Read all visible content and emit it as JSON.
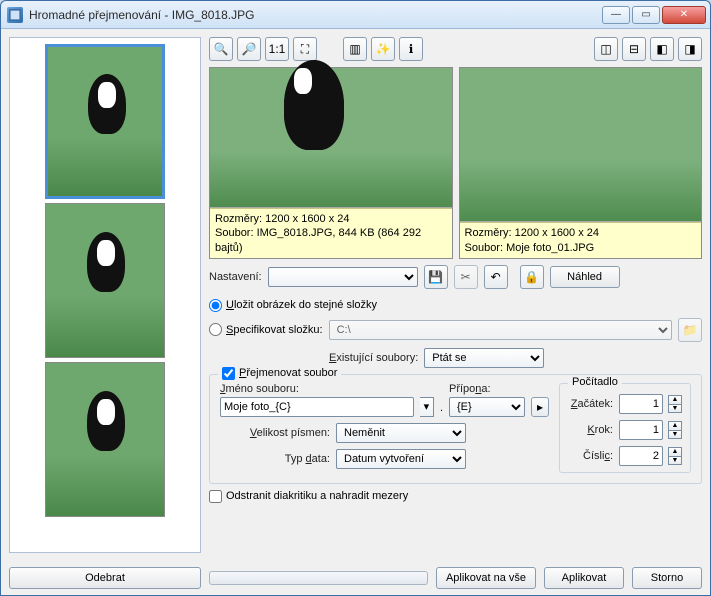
{
  "window": {
    "title": "Hromadné přejmenování - IMG_8018.JPG"
  },
  "toolbar": {
    "zoom_in": "zoom-in",
    "zoom_out": "zoom-out",
    "zoom_11": "1:1",
    "fit": "fit",
    "hist": "histogram",
    "new": "new",
    "info": "i",
    "layout1": "side-by-side",
    "layout2": "stacked",
    "layout3": "single-left",
    "layout4": "single-right"
  },
  "previews": {
    "left": {
      "dims_label": "Rozměry: 1200 x 1600 x 24",
      "file_label": "Soubor: IMG_8018.JPG, 844 KB (864 292 bajtů)"
    },
    "right": {
      "dims_label": "Rozměry: 1200 x 1600 x 24",
      "file_label": "Soubor: Moje foto_01.JPG"
    }
  },
  "settings": {
    "label": "Nastavení:",
    "value": "",
    "preview_button": "Náhled"
  },
  "radios": {
    "save_same_folder": "Uložit obrázek do stejné složky",
    "specify_folder": "Specifikovat složku:",
    "folder_value": "C:\\",
    "existing_label": "Existující soubory:",
    "existing_value": "Ptát se"
  },
  "rename": {
    "checkbox_label": "Přejmenovat soubor",
    "filename_label": "Jméno souboru:",
    "filename_value": "Moje foto_{C}",
    "dot": ".",
    "ext_label": "Přípona:",
    "ext_value": "{E}",
    "case_label": "Velikost písmen:",
    "case_value": "Neměnit",
    "date_label": "Typ data:",
    "date_value": "Datum vytvoření",
    "counter_legend": "Počítadlo",
    "start_label": "Začátek:",
    "start_value": "1",
    "step_label": "Krok:",
    "step_value": "1",
    "digits_label": "Číslic:",
    "digits_value": "2"
  },
  "diacritics": {
    "label": "Odstranit diakritiku a nahradit mezery"
  },
  "footer": {
    "remove": "Odebrat",
    "apply_all": "Aplikovat na vše",
    "apply": "Aplikovat",
    "cancel": "Storno"
  }
}
